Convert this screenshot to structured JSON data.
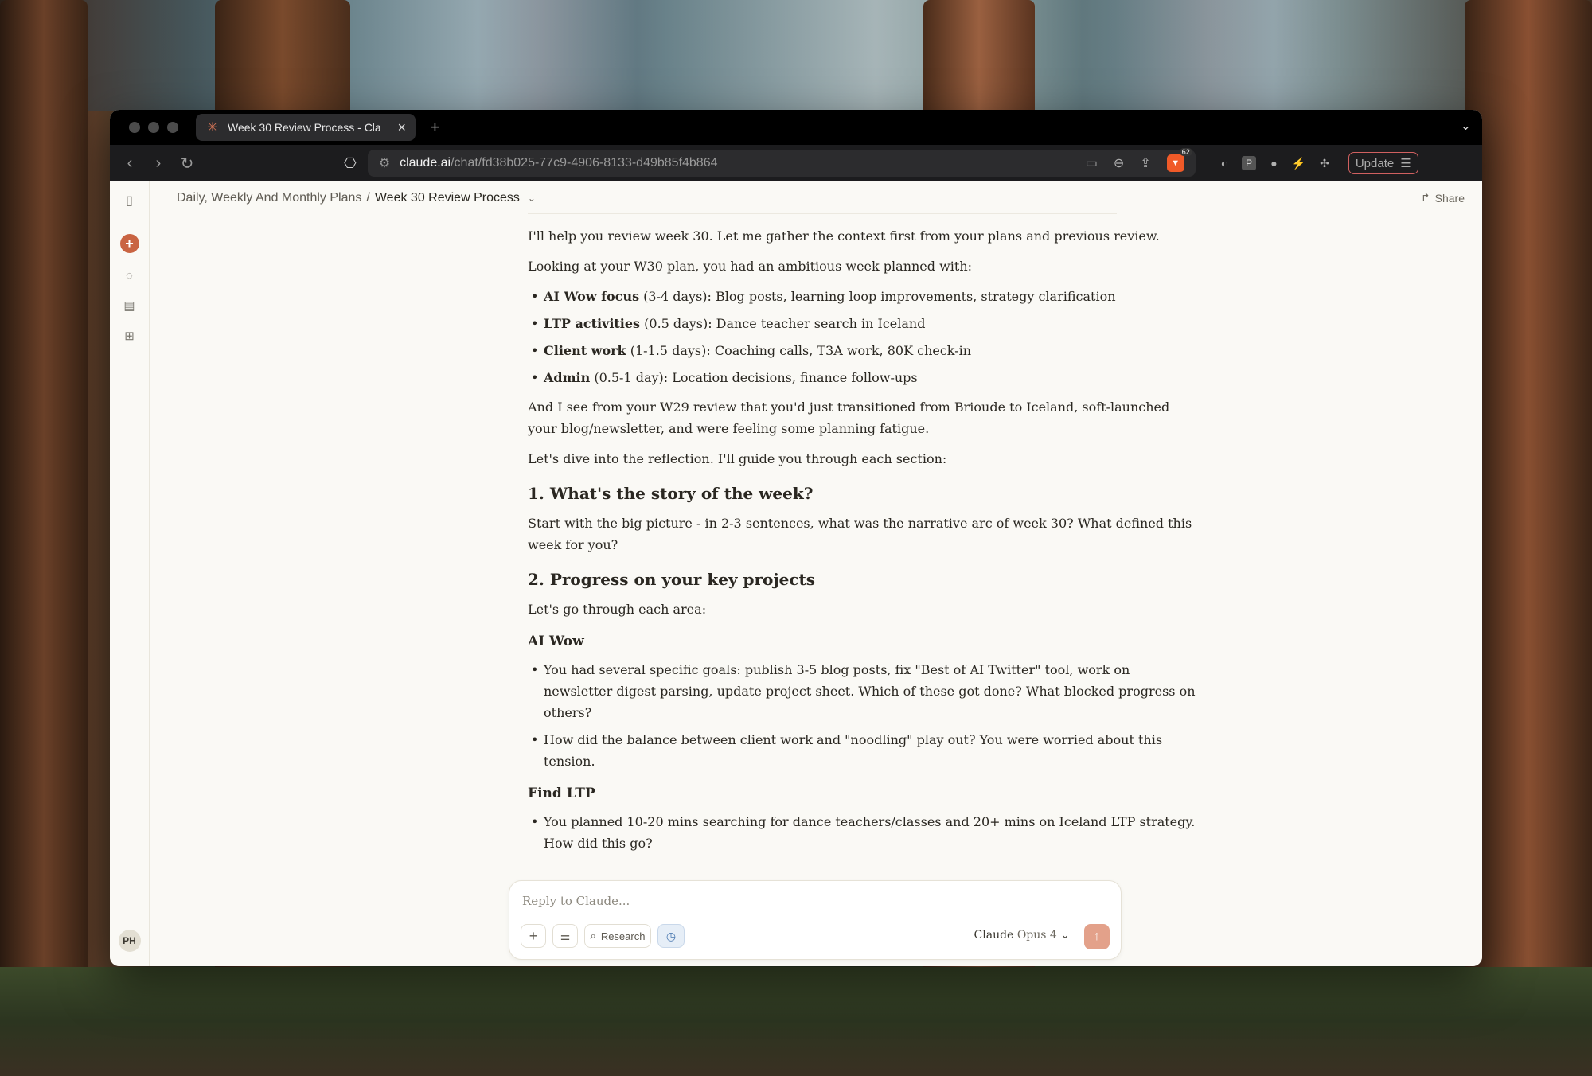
{
  "browser": {
    "tab_title": "Week 30 Review Process - Cla",
    "url_domain": "claude.ai",
    "url_path": "/chat/fd38b025-77c9-4906-8133-d49b85f4b864",
    "brave_count": "62",
    "update_label": "Update"
  },
  "header": {
    "project": "Daily, Weekly And Monthly Plans",
    "separator": "/",
    "chat_title": "Week 30 Review Process",
    "share_label": "Share"
  },
  "sidebar": {
    "avatar_initials": "PH"
  },
  "message": {
    "intro": "I'll help you review week 30. Let me gather the context first from your plans and previous review.",
    "plan_intro": "Looking at your W30 plan, you had an ambitious week planned with:",
    "plan_items": [
      {
        "label": "AI Wow focus",
        "text": " (3-4 days): Blog posts, learning loop improvements, strategy clarification"
      },
      {
        "label": "LTP activities",
        "text": " (0.5 days): Dance teacher search in Iceland"
      },
      {
        "label": "Client work",
        "text": " (1-1.5 days): Coaching calls, T3A work, 80K check-in"
      },
      {
        "label": "Admin",
        "text": " (0.5-1 day): Location decisions, finance follow-ups"
      }
    ],
    "w29_note": "And I see from your W29 review that you'd just transitioned from Brioude to Iceland, soft-launched your blog/newsletter, and were feeling some planning fatigue.",
    "dive_in": "Let's dive into the reflection. I'll guide you through each section:",
    "section1_heading": "1. What's the story of the week?",
    "section1_text": "Start with the big picture - in 2-3 sentences, what was the narrative arc of week 30? What defined this week for you?",
    "section2_heading": "2. Progress on your key projects",
    "section2_text": "Let's go through each area:",
    "aiwow_heading": "AI Wow",
    "aiwow_items": [
      "You had several specific goals: publish 3-5 blog posts, fix \"Best of AI Twitter\" tool, work on newsletter digest parsing, update project sheet. Which of these got done? What blocked progress on others?",
      "How did the balance between client work and \"noodling\" play out? You were worried about this tension."
    ],
    "ltp_heading": "Find LTP",
    "ltp_items": [
      "You planned 10-20 mins searching for dance teachers/classes and 20+ mins on Iceland LTP strategy. How did this go?"
    ]
  },
  "composer": {
    "placeholder": "Reply to Claude...",
    "research_label": "Research",
    "model_name": "Claude",
    "model_version": "Opus 4"
  }
}
